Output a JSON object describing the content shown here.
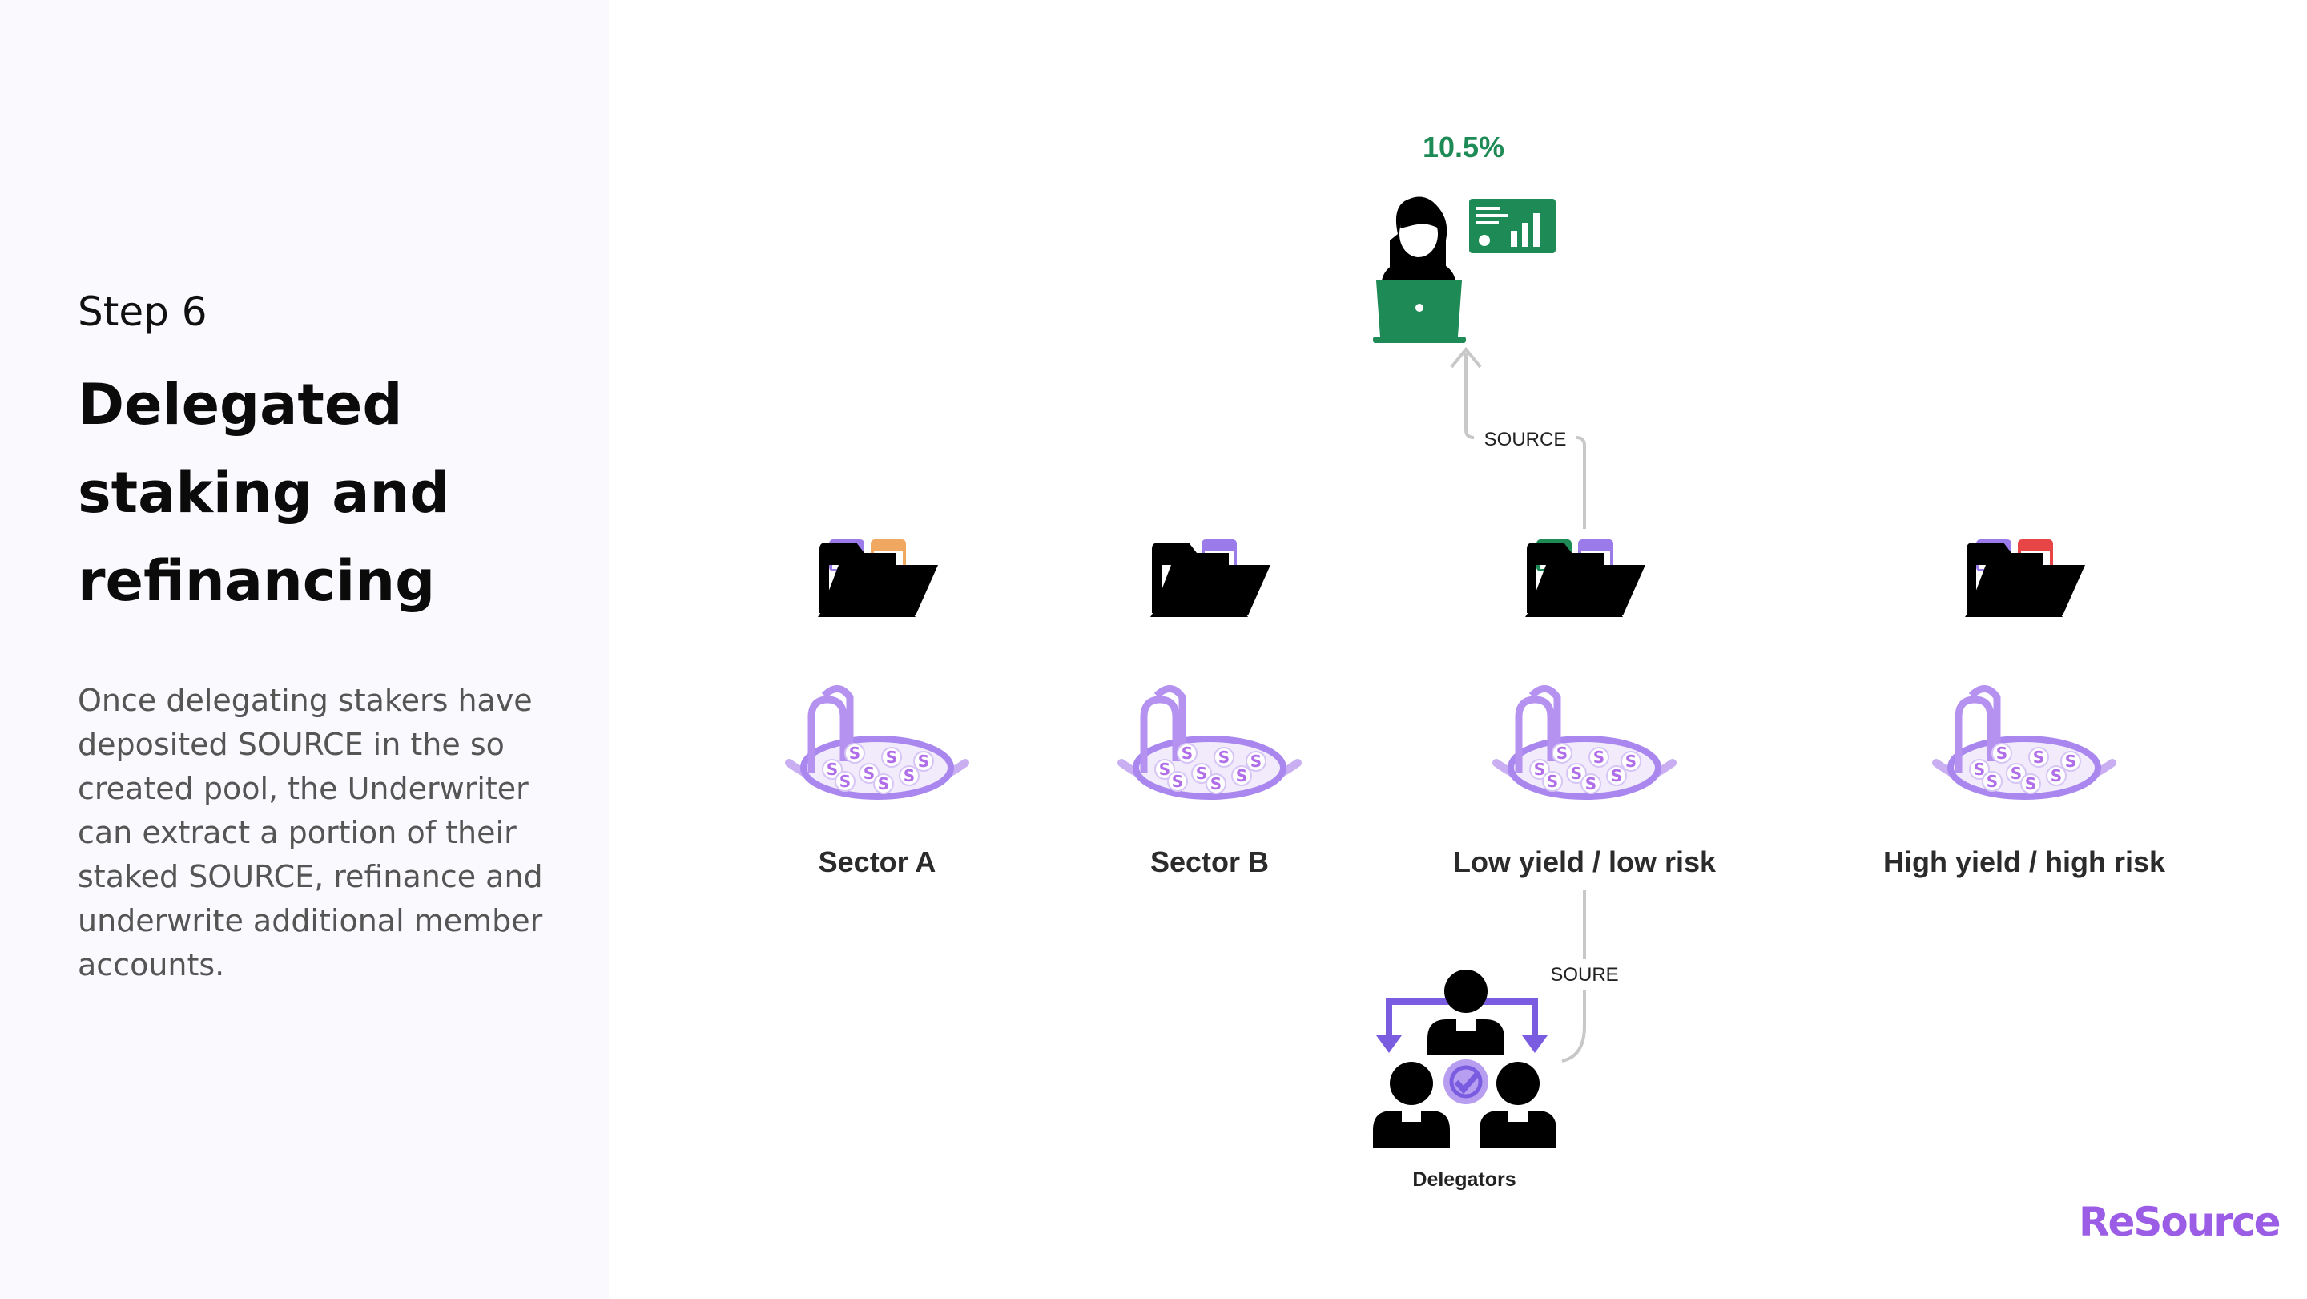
{
  "left_panel": {
    "step": "Step 6",
    "title": "Delegated staking and refinancing",
    "description": "Once delegating stakers have deposited SOURCE in the so created pool, the Underwriter can extract a portion of their staked SOURCE, refinance and underwrite additional member accounts."
  },
  "diagram": {
    "yield_label": "10.5%",
    "top_flow_label": "SOURCE",
    "bottom_flow_label": "SOURE",
    "delegators_label": "Delegators",
    "sectors": [
      {
        "label": "Sector A",
        "tab_colors": [
          "#9b7bea",
          "#f0a860"
        ]
      },
      {
        "label": "Sector B",
        "tab_colors": [
          "#9b7bea"
        ]
      },
      {
        "label": "Low yield / low risk",
        "tab_colors": [
          "#1e8a55",
          "#9b7bea"
        ]
      },
      {
        "label": "High yield / high risk",
        "tab_colors": [
          "#9b7bea",
          "#e84646"
        ]
      }
    ]
  },
  "colors": {
    "green": "#1e8a55",
    "purple": "#9b7bea",
    "lilac": "#c4a8f0",
    "brand": "#9b5de5",
    "connector": "#c8c8c8"
  },
  "icons": {
    "underwriter": "woman-with-laptop-icon",
    "chart": "dashboard-chart-icon",
    "folder": "folder-icon",
    "pool": "coin-pool-icon",
    "delegators": "group-of-people-icon"
  },
  "brand": {
    "logo_text": "ReSource"
  }
}
